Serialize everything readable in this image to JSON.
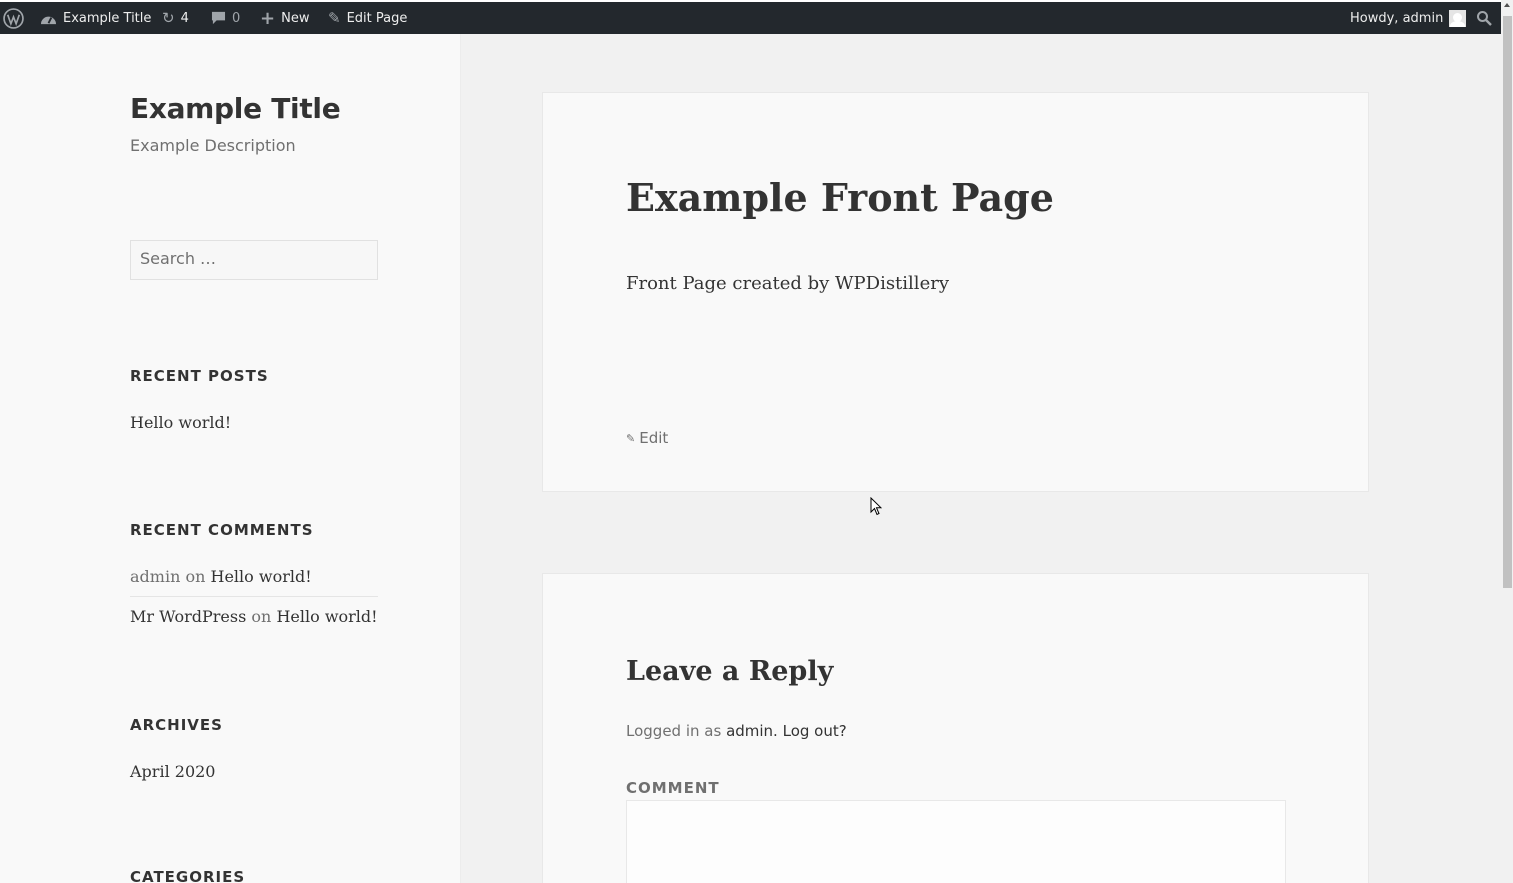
{
  "adminbar": {
    "site_name": "Example Title",
    "updates_count": "4",
    "comments_count": "0",
    "new_label": "New",
    "edit_label": "Edit Page",
    "howdy": "Howdy, admin"
  },
  "sidebar": {
    "site_title": "Example Title",
    "site_description": "Example Description",
    "search_placeholder": "Search …",
    "recent_posts_title": "RECENT POSTS",
    "recent_posts": [
      "Hello world!"
    ],
    "recent_comments_title": "RECENT COMMENTS",
    "recent_comments": [
      {
        "author": "admin",
        "on": "on",
        "post": "Hello world!"
      },
      {
        "author": "Mr WordPress",
        "on": "on",
        "post": "Hello world!"
      }
    ],
    "archives_title": "ARCHIVES",
    "archives": [
      "April 2020"
    ],
    "categories_title": "CATEGORIES"
  },
  "main": {
    "entry_title": "Example Front Page",
    "entry_content": "Front Page created by WPDistillery",
    "edit_link": "Edit",
    "reply_title": "Leave a Reply",
    "logged_in_prefix": "Logged in as",
    "logged_in_user": "admin.",
    "logout_link": "Log out?",
    "comment_label": "COMMENT"
  }
}
